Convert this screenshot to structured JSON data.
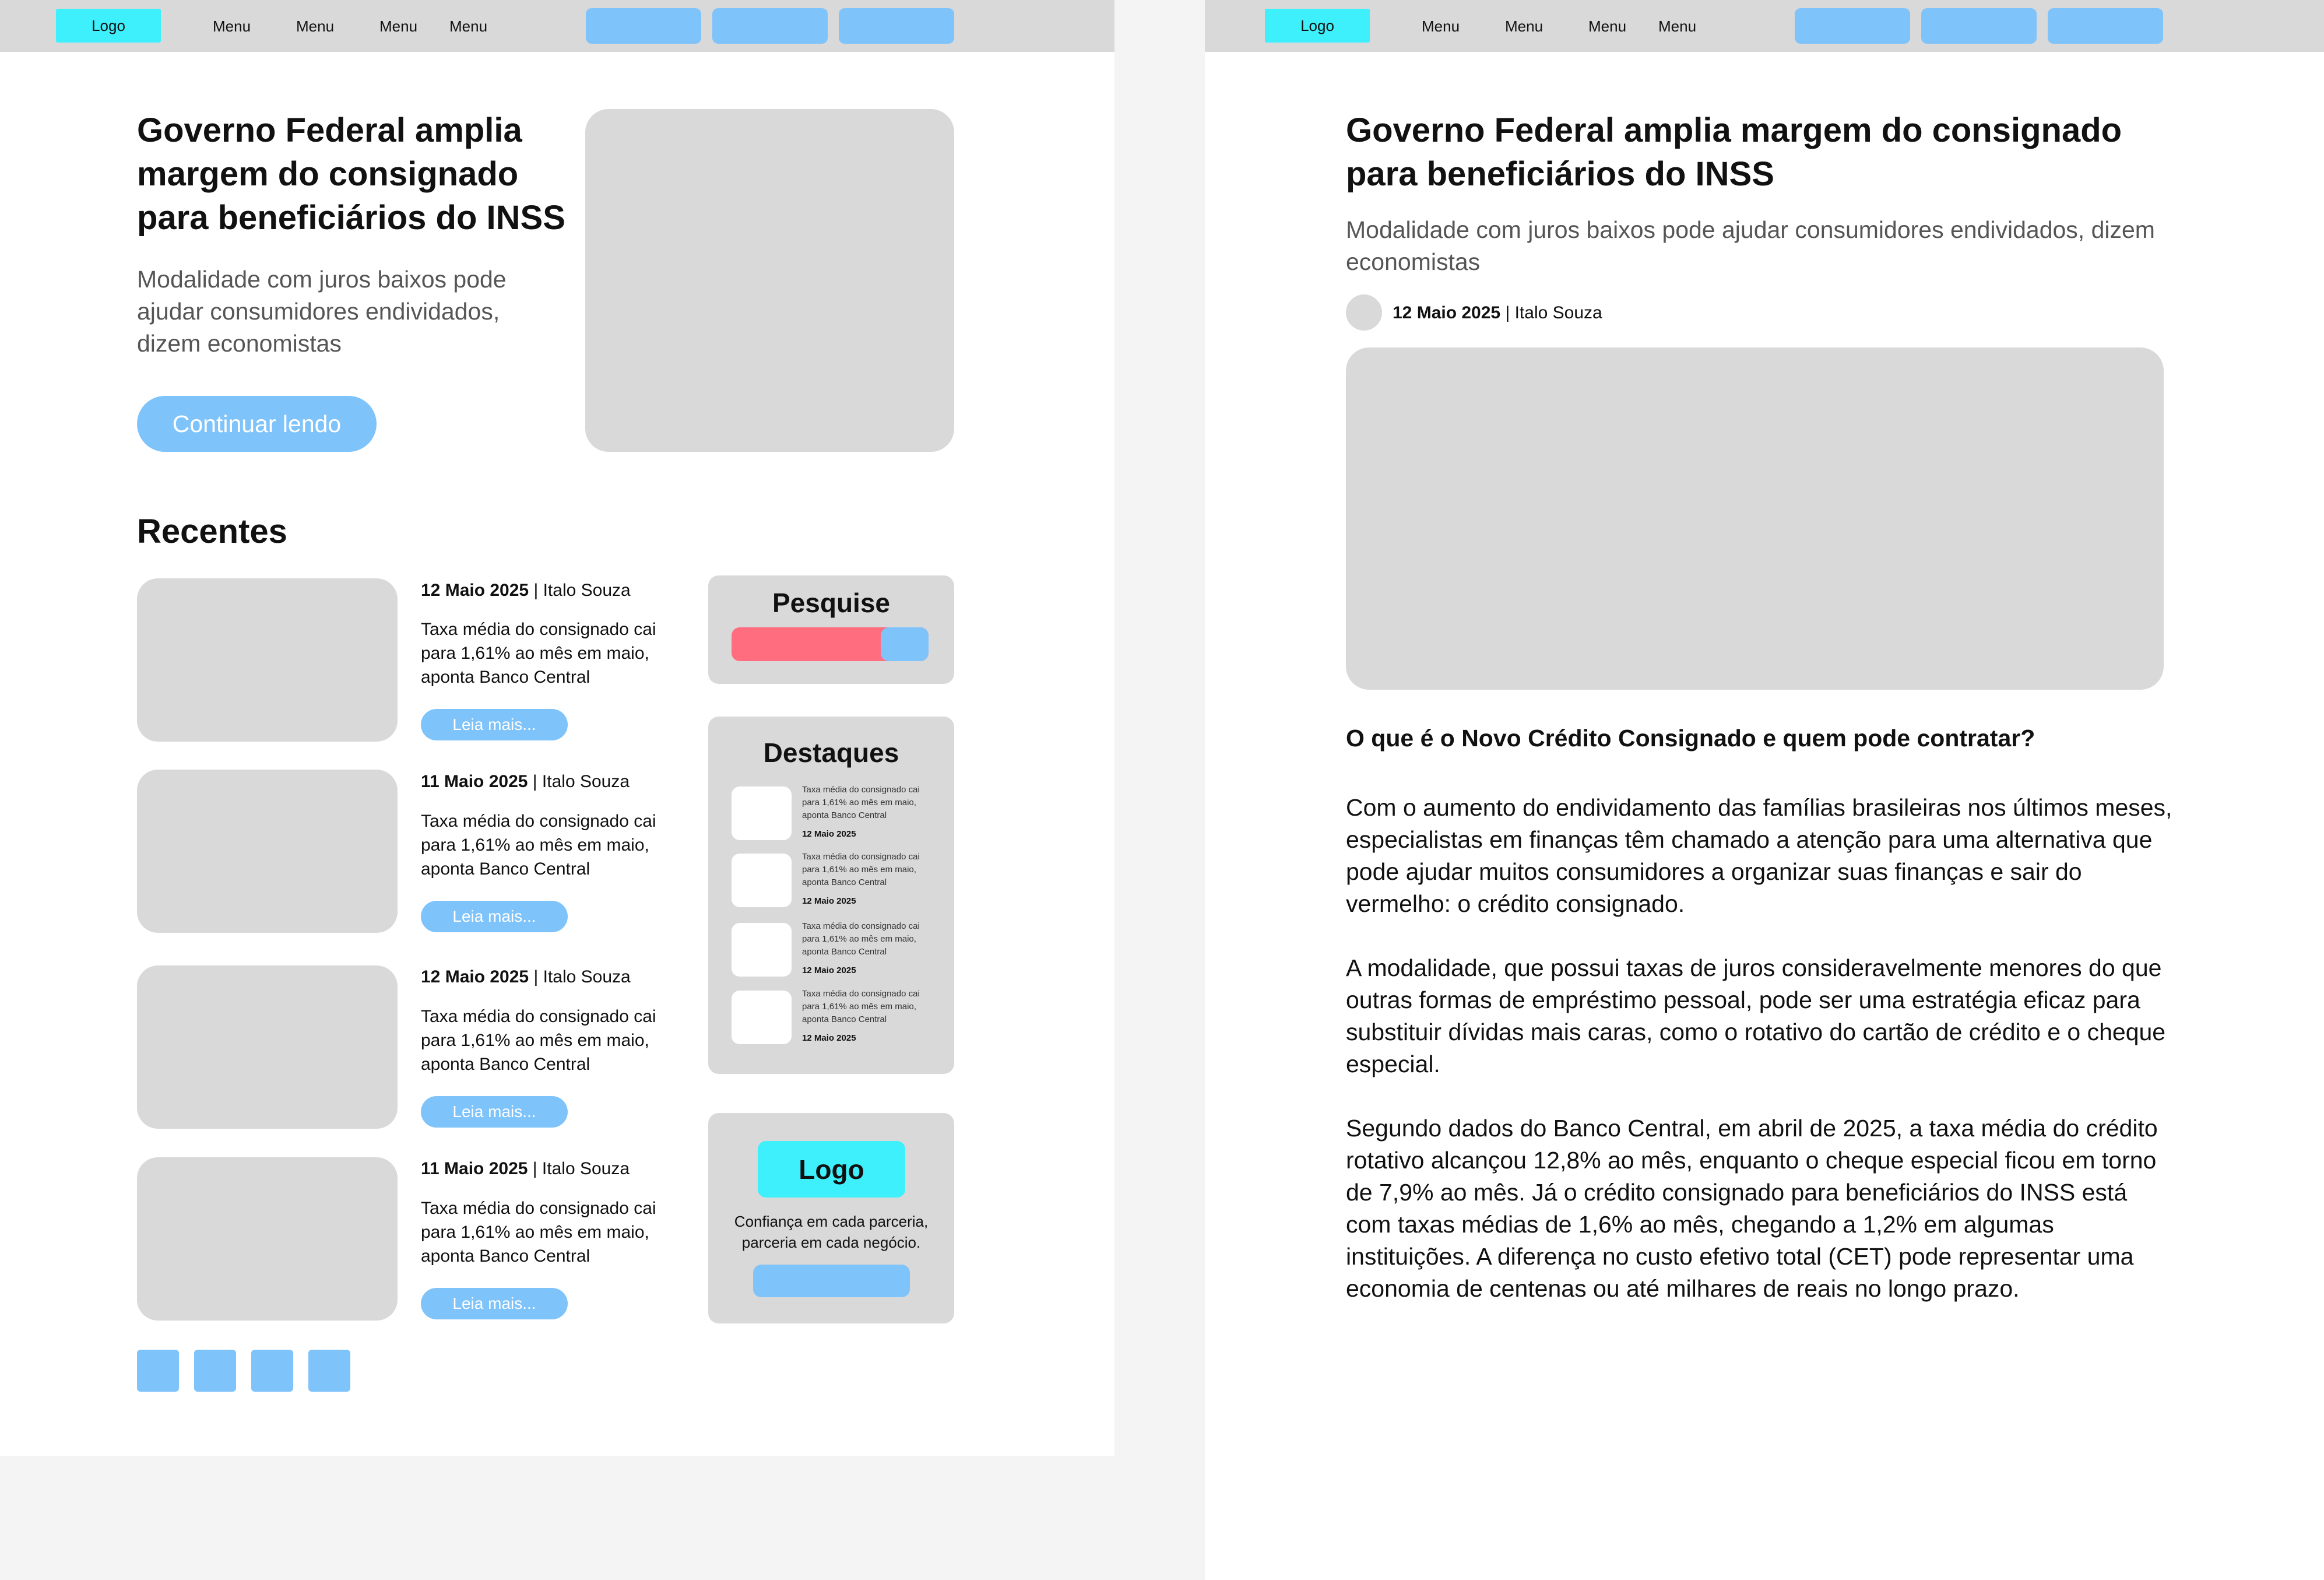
{
  "nav": {
    "logo": "Logo",
    "menu": [
      "Menu",
      "Menu",
      "Menu",
      "Menu"
    ]
  },
  "home": {
    "hero": {
      "title": "Governo Federal amplia margem do consignado para beneficiários do INSS",
      "subtitle": "Modalidade com juros baixos pode ajudar consumidores endividados, dizem economistas",
      "cta": "Continuar lendo"
    },
    "recent": {
      "title": "Recentes",
      "items": [
        {
          "date": "12 Maio 2025",
          "author": " | Italo Souza",
          "text": "Taxa média do consignado cai para 1,61% ao mês em maio, aponta Banco Central",
          "more": "Leia mais..."
        },
        {
          "date": "11 Maio 2025",
          "author": " | Italo Souza",
          "text": "Taxa média do consignado cai para 1,61% ao mês em maio, aponta Banco Central",
          "more": "Leia mais..."
        },
        {
          "date": "12 Maio 2025",
          "author": " | Italo Souza",
          "text": "Taxa média do consignado cai para 1,61% ao mês em maio, aponta Banco Central",
          "more": "Leia mais..."
        },
        {
          "date": "11 Maio 2025",
          "author": " | Italo Souza",
          "text": "Taxa média do consignado cai para 1,61% ao mês em maio, aponta Banco Central",
          "more": "Leia mais..."
        }
      ]
    },
    "search": {
      "title": "Pesquise"
    },
    "featured": {
      "title": "Destaques",
      "items": [
        {
          "text": "Taxa média do consignado cai para 1,61% ao mês em maio, aponta Banco Central",
          "date": "12 Maio 2025"
        },
        {
          "text": "Taxa média do consignado cai para 1,61% ao mês em maio, aponta Banco Central",
          "date": "12 Maio 2025"
        },
        {
          "text": "Taxa média do consignado cai para 1,61% ao mês em maio, aponta Banco Central",
          "date": "12 Maio 2025"
        },
        {
          "text": "Taxa média do consignado cai para 1,61% ao mês em maio, aponta Banco Central",
          "date": "12 Maio 2025"
        }
      ]
    },
    "promo": {
      "logo": "Logo",
      "tagline": "Confiança em cada parceria, parceria em cada negócio."
    }
  },
  "article": {
    "title": "Governo Federal amplia margem do consignado para beneficiários do INSS",
    "subtitle": "Modalidade com juros baixos pode ajudar consumidores endividados, dizem economistas",
    "date": "12 Maio 2025",
    "author": " | Italo Souza",
    "heading": "O que é o Novo Crédito Consignado e quem pode contratar?",
    "paragraphs": [
      "Com o aumento do endividamento das famílias brasileiras nos últimos meses, especialistas em finanças têm chamado a atenção para uma alternativa que pode ajudar muitos consumidores a organizar suas finanças e sair do vermelho: o crédito consignado.",
      "A modalidade, que possui taxas de juros consideravelmente menores do que outras formas de empréstimo pessoal, pode ser uma estratégia eficaz para substituir dívidas mais caras, como o rotativo do cartão de crédito e o cheque especial.",
      "Segundo dados do Banco Central, em abril de 2025, a taxa média do crédito rotativo alcançou 12,8% ao mês, enquanto o cheque especial ficou em torno de 7,9% ao mês. Já o crédito consignado para beneficiários do INSS está com taxas médias de 1,6% ao mês, chegando a 1,2% em algumas instituições. A diferença no custo efetivo total (CET) pode representar uma economia de centenas ou até milhares de reais no longo prazo."
    ]
  },
  "colors": {
    "accent_cyan": "#3ef0fb",
    "accent_blue": "#7fc3fb",
    "search_red": "#ff6d7f",
    "placeholder_gray": "#d9d9d9"
  }
}
